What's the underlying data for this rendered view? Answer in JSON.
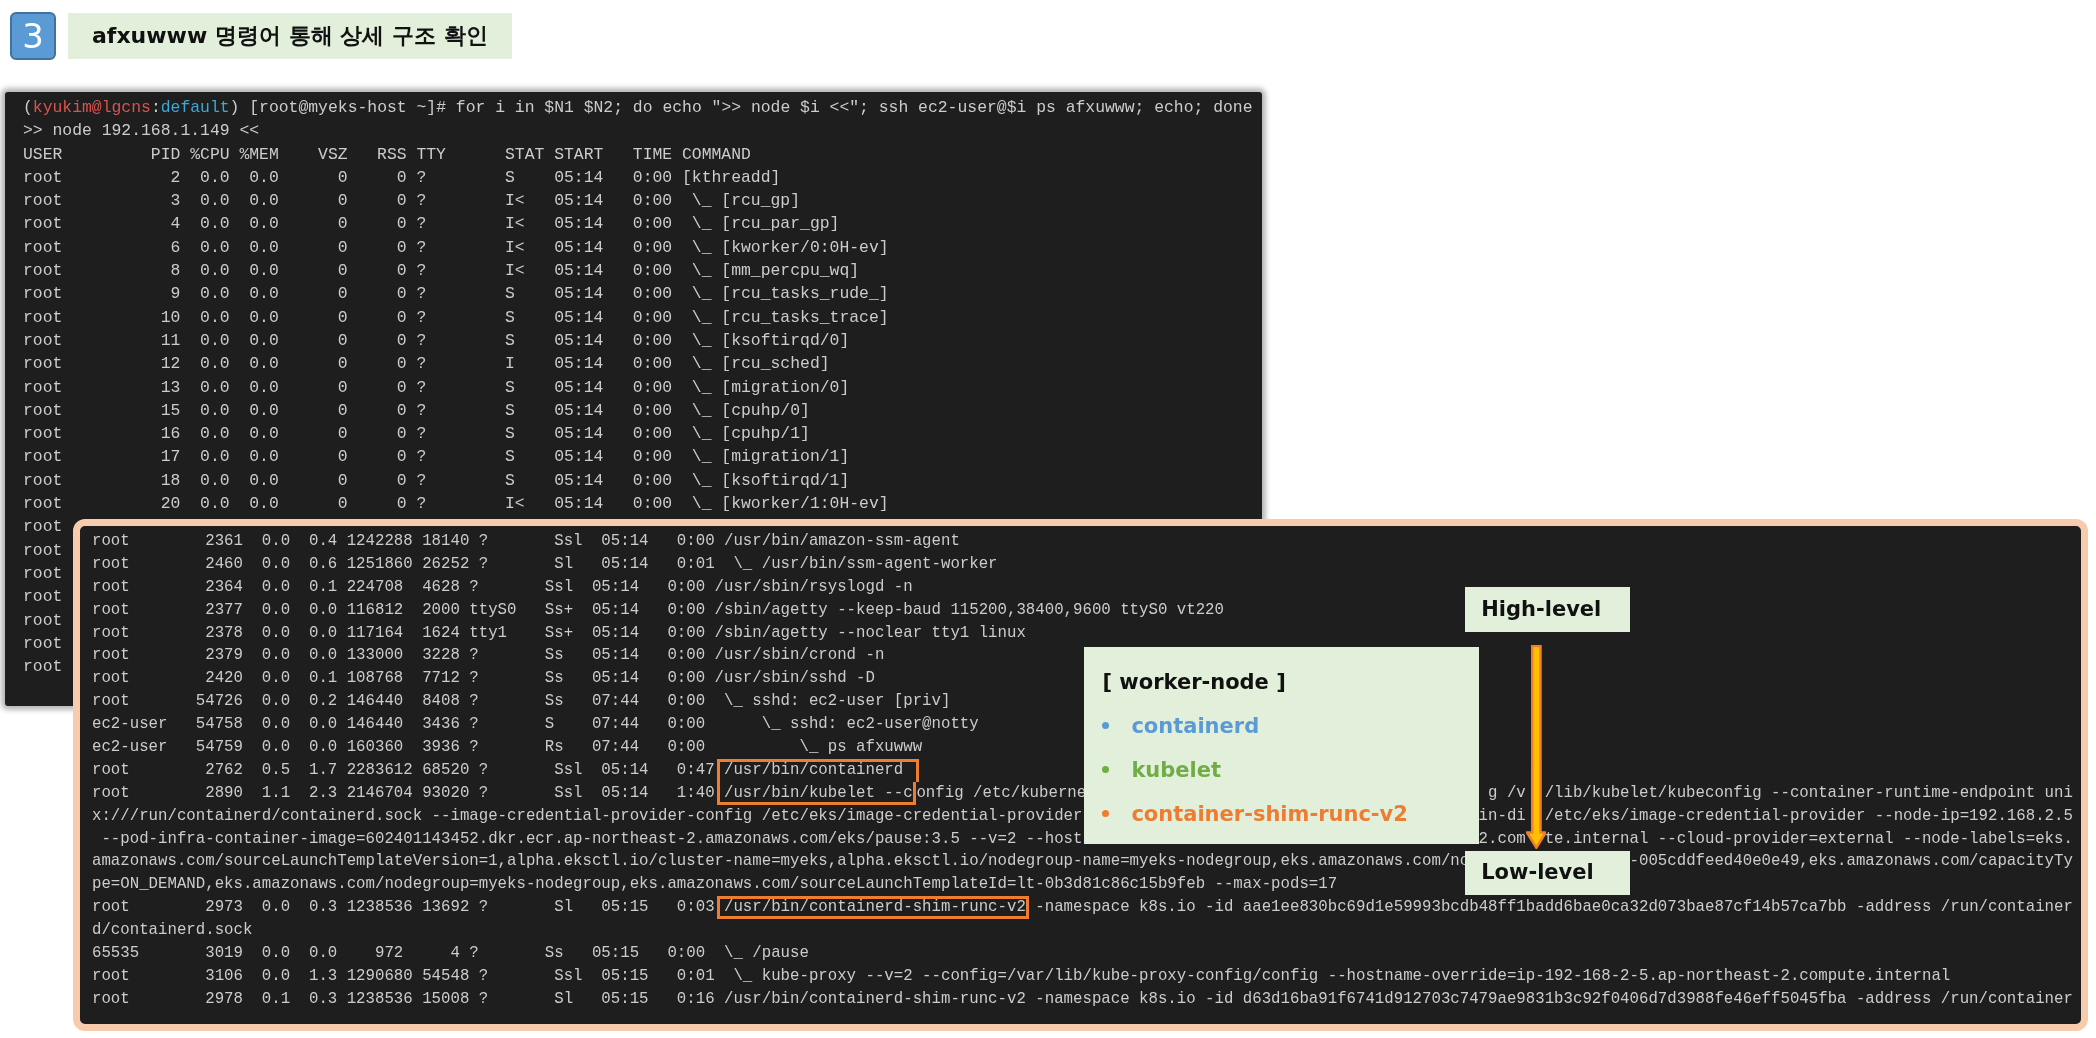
{
  "step": {
    "number": "3",
    "title": "afxuwww 명령어 통해 상세 구조 확인"
  },
  "terminal_1": {
    "prompt": [
      {
        "kind": "plain",
        "text": "("
      },
      {
        "kind": "user",
        "text": "kyukim@lgcns"
      },
      {
        "kind": "plain",
        "text": ":"
      },
      {
        "kind": "context",
        "text": "default"
      },
      {
        "kind": "plain",
        "text": ") [root@myeks-host ~]# for i in $N1 $N2; do echo \">> node $i <<\"; ssh ec2-user@$i ps afxuwww; echo; done"
      }
    ],
    "lines": [
      ">> node 192.168.1.149 <<",
      "USER         PID %CPU %MEM    VSZ   RSS TTY      STAT START   TIME COMMAND",
      "root           2  0.0  0.0      0     0 ?        S    05:14   0:00 [kthreadd]",
      "root           3  0.0  0.0      0     0 ?        I<   05:14   0:00  \\_ [rcu_gp]",
      "root           4  0.0  0.0      0     0 ?        I<   05:14   0:00  \\_ [rcu_par_gp]",
      "root           6  0.0  0.0      0     0 ?        I<   05:14   0:00  \\_ [kworker/0:0H-ev]",
      "root           8  0.0  0.0      0     0 ?        I<   05:14   0:00  \\_ [mm_percpu_wq]",
      "root           9  0.0  0.0      0     0 ?        S    05:14   0:00  \\_ [rcu_tasks_rude_]",
      "root          10  0.0  0.0      0     0 ?        S    05:14   0:00  \\_ [rcu_tasks_trace]",
      "root          11  0.0  0.0      0     0 ?        S    05:14   0:00  \\_ [ksoftirqd/0]",
      "root          12  0.0  0.0      0     0 ?        I    05:14   0:00  \\_ [rcu_sched]",
      "root          13  0.0  0.0      0     0 ?        S    05:14   0:00  \\_ [migration/0]",
      "root          15  0.0  0.0      0     0 ?        S    05:14   0:00  \\_ [cpuhp/0]",
      "root          16  0.0  0.0      0     0 ?        S    05:14   0:00  \\_ [cpuhp/1]",
      "root          17  0.0  0.0      0     0 ?        S    05:14   0:00  \\_ [migration/1]",
      "root          18  0.0  0.0      0     0 ?        S    05:14   0:00  \\_ [ksoftirqd/1]",
      "root          20  0.0  0.0      0     0 ?        I<   05:14   0:00  \\_ [kworker/1:0H-ev]"
    ],
    "partial_lines": [
      "root",
      "root",
      "root",
      "root",
      "root",
      "root",
      "root"
    ]
  },
  "terminal_2": {
    "lines": [
      {
        "parts": [
          "root        2361  0.0  0.4 1242288 18140 ?       Ssl  05:14   0:00 /usr/bin/amazon-ssm-agent"
        ]
      },
      {
        "parts": [
          "root        2460  0.0  0.6 1251860 26252 ?       Sl   05:14   0:01  \\_ /usr/bin/ssm-agent-worker"
        ]
      },
      {
        "parts": [
          "root        2364  0.0  0.1 224708  4628 ?       Ssl  05:14   0:00 /usr/sbin/rsyslogd -n"
        ]
      },
      {
        "parts": [
          "root        2377  0.0  0.0 116812  2000 ttyS0   Ss+  05:14   0:00 /sbin/agetty --keep-baud 115200,38400,9600 ttyS0 vt220"
        ]
      },
      {
        "parts": [
          "root        2378  0.0  0.0 117164  1624 tty1    Ss+  05:14   0:00 /sbin/agetty --noclear tty1 linux"
        ]
      },
      {
        "parts": [
          "root        2379  0.0  0.0 133000  3228 ?       Ss   05:14   0:00 /usr/sbin/crond -n"
        ]
      },
      {
        "parts": [
          "root        2420  0.0  0.1 108768  7712 ?       Ss   05:14   0:00 /usr/sbin/sshd -D"
        ]
      },
      {
        "parts": [
          "root       54726  0.0  0.2 146440  8408 ?       Ss   07:44   0:00  \\_ sshd: ec2-user [priv]"
        ]
      },
      {
        "parts": [
          "ec2-user   54758  0.0  0.0 146440  3436 ?       S    07:44   0:00      \\_ sshd: ec2-user@notty"
        ]
      },
      {
        "parts": [
          "ec2-user   54759  0.0  0.0 160360  3936 ?       Rs   07:44   0:00          \\_ ps afxuwww"
        ]
      },
      {
        "parts": [
          "root        2762  0.5  1.7 2283612 68520 ?       Ssl  05:14   0:47 ",
          {
            "kind": "framed_top",
            "text": "/usr/bin/containerd"
          }
        ]
      },
      {
        "parts": [
          "root        2890  1.1  2.3 2146704 93020 ?       Ssl  05:14   1:40 ",
          {
            "kind": "framed_bottom",
            "text": "/usr/bin/kubelet --c"
          },
          "onfig /etc/kuberne",
          {
            "kind": "right",
            "text": "g /v"
          },
          {
            "kind": "after_arrow",
            "text": "/lib/kubelet/kubeconfig --container-runtime-endpoint uni"
          }
        ]
      },
      {
        "parts": [
          "x:///run/containerd/containerd.sock --image-credential-provider-config /etc/eks/image-credential-provider",
          {
            "kind": "right",
            "text": "in-di"
          },
          {
            "kind": "after_arrow",
            "text": "/etc/eks/image-credential-provider --node-ip=192.168.2.5"
          }
        ]
      },
      {
        "parts": [
          " --pod-infra-container-image=602401143452.dkr.ecr.ap-northeast-2.amazonaws.com/eks/pause:3.5 --v=2 --host",
          {
            "kind": "right",
            "text": "2.com"
          },
          {
            "kind": "after_arrow",
            "text": "te.internal --cloud-provider=external --node-labels=eks."
          }
        ]
      },
      {
        "parts": [
          "amazonaws.com/sourceLaunchTemplateVersion=1,alpha.eksctl.io/cluster-name=myeks,alpha.eksctl.io/nodegroup-name=myeks-nodegroup,eks.amazonaws.com/no",
          {
            "kind": "right",
            "text": "-005cddfeed40e0e49,eks.amazonaws.com/capacityTy"
          }
        ]
      },
      {
        "parts": [
          "pe=ON_DEMAND,eks.amazonaws.com/nodegroup=myeks-nodegroup,eks.amazonaws.com/sourceLaunchTemplateId=lt-0b3d81c86c15b9feb --max-pods=17"
        ]
      },
      {
        "parts": [
          "root        2973  0.0  0.3 1238536 13692 ?       Sl   05:15   0:03 ",
          {
            "kind": "framed",
            "text": "/usr/bin/containerd-shim-runc-v2"
          },
          " -namespace k8s.io -id aae1ee830bc69d1e59993bcdb48ff1badd6bae0ca32d073bae87cf14b57ca7bb -address /run/container"
        ]
      },
      {
        "parts": [
          "d/containerd.sock"
        ]
      },
      {
        "parts": [
          "65535       3019  0.0  0.0    972     4 ?       Ss   05:15   0:00  \\_ /pause"
        ]
      },
      {
        "parts": [
          "root        3106  0.0  1.3 1290680 54548 ?       Ssl  05:15   0:01  \\_ kube-proxy --v=2 --config=/var/lib/kube-proxy-config/config --hostname-override=ip-192-168-2-5.ap-northeast-2.compute.internal"
        ]
      },
      {
        "parts": [
          "root        2978  0.1  0.3 1238536 15008 ?       Sl   05:15   0:16 /usr/bin/containerd-shim-runc-v2 -namespace k8s.io -id d63d16ba91f6741d912703c7479ae9831b3c92f0406d7d3988fe46eff5045fba -address /run/container"
        ]
      }
    ]
  },
  "worker_node": {
    "title": "[ worker-node ]",
    "items": [
      {
        "text": "containerd",
        "color": "#5b9bd5"
      },
      {
        "text": "kubelet",
        "color": "#70ad47"
      },
      {
        "text": "container-shim-runc-v2",
        "color": "#ed7d31"
      }
    ]
  },
  "level_labels": {
    "high": "High-level",
    "low": "Low-level"
  }
}
